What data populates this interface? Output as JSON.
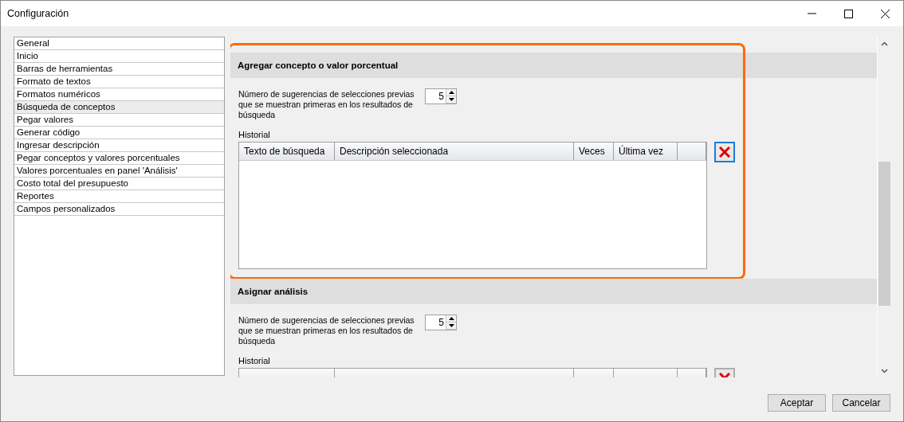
{
  "window": {
    "title": "Configuración"
  },
  "sidebar": {
    "items": [
      {
        "label": "General",
        "selected": false
      },
      {
        "label": "Inicio",
        "selected": false
      },
      {
        "label": "Barras de herramientas",
        "selected": false
      },
      {
        "label": "Formato de textos",
        "selected": false
      },
      {
        "label": "Formatos numéricos",
        "selected": false
      },
      {
        "label": "Búsqueda de conceptos",
        "selected": true
      },
      {
        "label": "Pegar valores",
        "selected": false
      },
      {
        "label": "Generar código",
        "selected": false
      },
      {
        "label": "Ingresar descripción",
        "selected": false
      },
      {
        "label": "Pegar conceptos y valores porcentuales",
        "selected": false
      },
      {
        "label": "Valores porcentuales en panel 'Análisis'",
        "selected": false
      },
      {
        "label": "Costo total del presupuesto",
        "selected": false
      },
      {
        "label": "Reportes",
        "selected": false
      },
      {
        "label": "Campos personalizados",
        "selected": false
      }
    ]
  },
  "sections": [
    {
      "title": "Agregar concepto o valor porcentual",
      "highlighted": true,
      "suggestions_label": "Número de sugerencias de selecciones previas que se muestran primeras en los resultados de búsqueda",
      "suggestions_value": "5",
      "history_label": "Historial",
      "columns": [
        "Texto de búsqueda",
        "Descripción seleccionada",
        "Veces",
        "Última vez"
      ]
    },
    {
      "title": "Asignar análisis",
      "highlighted": false,
      "suggestions_label": "Número de sugerencias de selecciones previas que se muestran primeras en los resultados de búsqueda",
      "suggestions_value": "5",
      "history_label": "Historial"
    }
  ],
  "buttons": [
    "Aceptar",
    "Cancelar"
  ]
}
